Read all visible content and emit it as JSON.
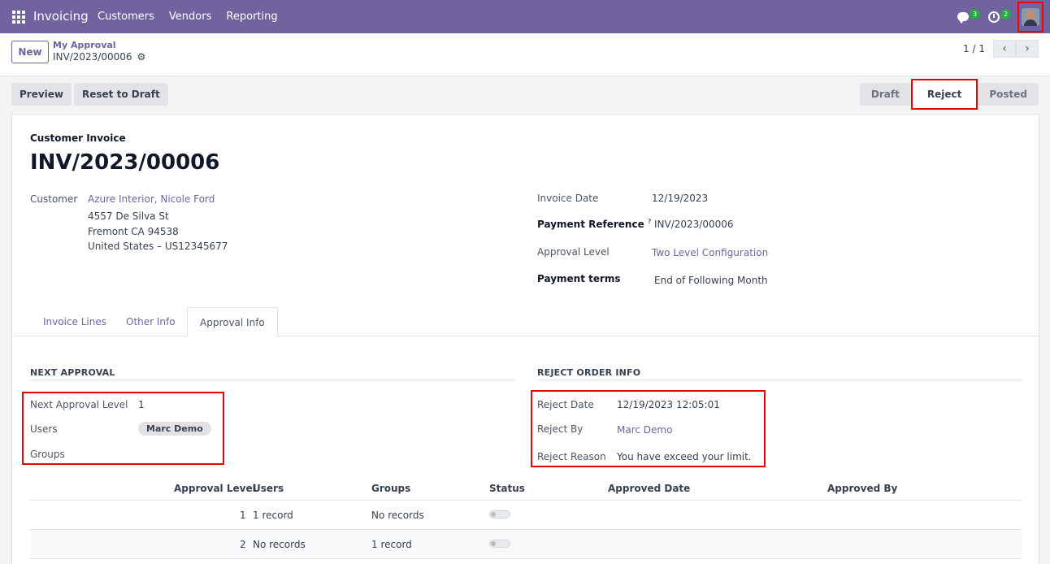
{
  "navbar": {
    "app_name": "Invoicing",
    "menu": [
      "Customers",
      "Vendors",
      "Reporting"
    ],
    "chat_count": "3",
    "activity_count": "2"
  },
  "control_panel": {
    "new_label": "New",
    "breadcrumb_parent": "My Approval",
    "breadcrumb_current": "INV/2023/00006",
    "pager": "1 / 1"
  },
  "actions": {
    "preview": "Preview",
    "reset_to_draft": "Reset to Draft"
  },
  "statusbar": {
    "stages": [
      "Draft",
      "Reject",
      "Posted"
    ],
    "active": "Reject"
  },
  "invoice": {
    "doc_type": "Customer Invoice",
    "number": "INV/2023/00006",
    "customer_label": "Customer",
    "customer_name": "Azure Interior, Nicole Ford",
    "address_line1": "4557 De Silva St",
    "address_line2": "Fremont CA 94538",
    "address_line3": "United States – US12345677",
    "invoice_date_label": "Invoice Date",
    "invoice_date": "12/19/2023",
    "payment_reference_label": "Payment Reference",
    "payment_reference_help": "?",
    "payment_reference": "INV/2023/00006",
    "approval_level_label": "Approval Level",
    "approval_level": "Two Level Configuration",
    "payment_terms_label": "Payment terms",
    "payment_terms": "End of Following Month"
  },
  "tabs": [
    "Invoice Lines",
    "Other Info",
    "Approval Info"
  ],
  "next_approval": {
    "title": "NEXT APPROVAL",
    "level_label": "Next Approval Level",
    "level_value": "1",
    "users_label": "Users",
    "users_tag": "Marc Demo",
    "groups_label": "Groups"
  },
  "reject_info": {
    "title": "REJECT ORDER INFO",
    "date_label": "Reject Date",
    "date_value": "12/19/2023 12:05:01",
    "by_label": "Reject By",
    "by_value": "Marc Demo",
    "reason_label": "Reject Reason",
    "reason_value": "You have exceed your limit."
  },
  "approval_table": {
    "columns": [
      "Approval Level",
      "Users",
      "Groups",
      "Status",
      "Approved Date",
      "Approved By"
    ],
    "rows": [
      {
        "level": "1",
        "users": "1 record",
        "groups": "No records",
        "status": false
      },
      {
        "level": "2",
        "users": "No records",
        "groups": "1 record",
        "status": false
      }
    ]
  }
}
